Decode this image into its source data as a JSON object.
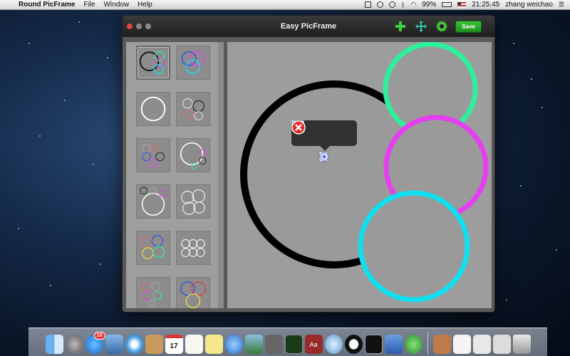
{
  "menubar": {
    "app_name": "Round PicFrame",
    "menus": [
      "File",
      "Window",
      "Help"
    ],
    "battery": "99%",
    "time": "21:25:45",
    "user": "zhang weichao"
  },
  "window": {
    "title": "Easy PicFrame",
    "save_label": "Save"
  },
  "templates": [
    {
      "name": "template-1",
      "selected": true
    },
    {
      "name": "template-2"
    },
    {
      "name": "template-3"
    },
    {
      "name": "template-4"
    },
    {
      "name": "template-5"
    },
    {
      "name": "template-6"
    },
    {
      "name": "template-7"
    },
    {
      "name": "template-8"
    },
    {
      "name": "template-9"
    },
    {
      "name": "template-10"
    },
    {
      "name": "template-11"
    },
    {
      "name": "template-12"
    }
  ],
  "frame_colors": {
    "large": "#000000",
    "green": "#2ef09a",
    "magenta": "#e63ef0",
    "cyan": "#0ee0f0"
  },
  "dock": {
    "app_store_badge": "10",
    "calendar_day": "17"
  }
}
